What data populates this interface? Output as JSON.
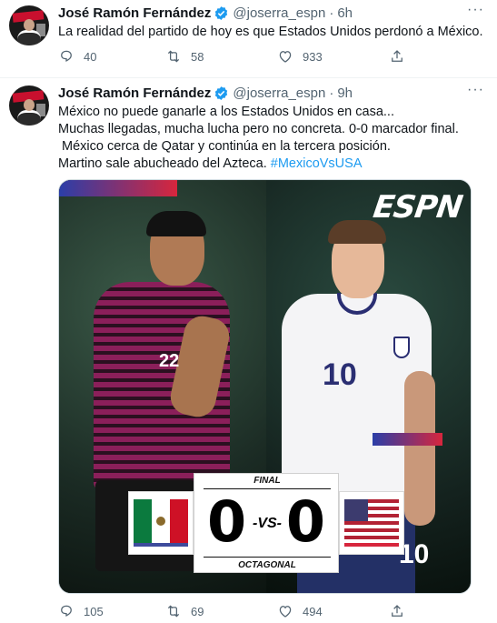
{
  "tweets": [
    {
      "author_name": "José Ramón Fernández",
      "handle": "@joserra_espn",
      "separator": "·",
      "time": "6h",
      "more": "···",
      "text_lines": [
        "La realidad del partido de hoy es que Estados Unidos perdonó a México."
      ],
      "replies": "40",
      "retweets": "58",
      "likes": "933"
    },
    {
      "author_name": "José Ramón Fernández",
      "handle": "@joserra_espn",
      "separator": "·",
      "time": "9h",
      "more": "···",
      "text_lines": [
        "México no puede ganarle a los Estados Unidos en casa...",
        "Muchas llegadas, mucha lucha pero no concreta. 0-0 marcador final.",
        " México cerca de Qatar y continúa en la tercera posición.",
        "Martino sale abucheado del Azteca."
      ],
      "hashtag": "#MexicoVsUSA",
      "media": {
        "brand": "ESPN",
        "label_top": "FINAL",
        "label_bottom": "OCTAGONAL",
        "home_score": "0",
        "away_score": "0",
        "vs": "-VS-",
        "mx_number": "22",
        "us_number": "10",
        "us_short_number": "10"
      },
      "replies": "105",
      "retweets": "69",
      "likes": "494"
    }
  ],
  "icons": {
    "reply": "reply-icon",
    "retweet": "retweet-icon",
    "like": "like-icon",
    "share": "share-icon",
    "verified": "verified-badge-icon"
  },
  "colors": {
    "link": "#1d9bf0",
    "secondary_text": "#536471",
    "verified": "#1d9bf0"
  }
}
